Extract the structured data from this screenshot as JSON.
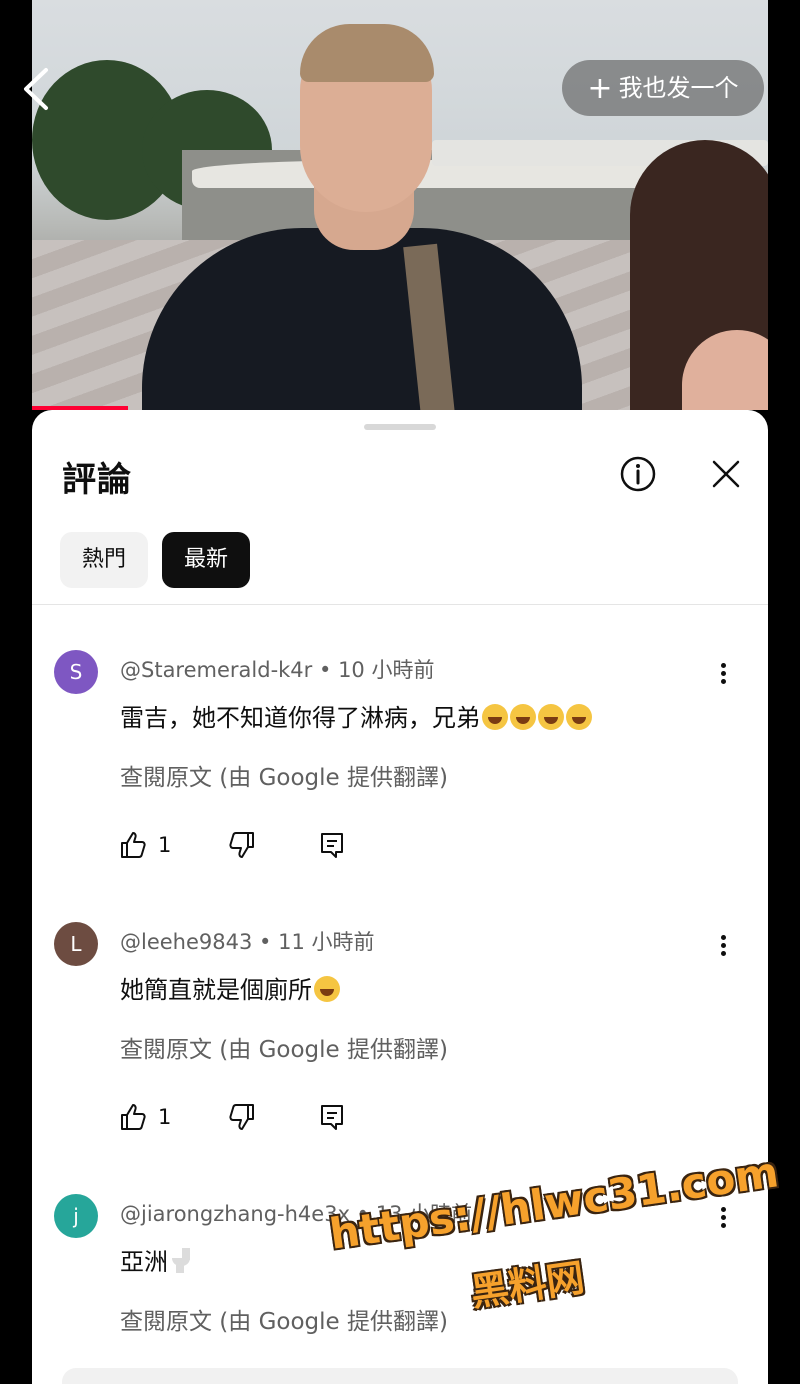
{
  "video": {
    "create_button_label": "我也发一个",
    "create_button_icon": "plus-icon",
    "back_icon": "chevron-left-icon",
    "progress_fraction": 0.13,
    "progress_color": "#ff0033"
  },
  "sheet": {
    "title": "評論",
    "info_icon": "info-icon",
    "close_icon": "close-icon",
    "chips": [
      {
        "label": "熱門",
        "selected": false
      },
      {
        "label": "最新",
        "selected": true
      }
    ]
  },
  "comments": [
    {
      "avatar_letter": "S",
      "avatar_color": "#7e57c2",
      "handle": "@Staremerald-k4r",
      "time": "10 小時前",
      "text": "雷吉，她不知道你得了淋病，兄弟",
      "emoji": "grinning-squint-face",
      "emoji_count": 4,
      "translate_label": "查閱原文 (由 Google 提供翻譯)",
      "likes": "1"
    },
    {
      "avatar_letter": "L",
      "avatar_color": "#6d4c41",
      "handle": "@leehe9843",
      "time": "11 小時前",
      "text": "她簡直就是個廁所",
      "emoji": "grinning-squint-face",
      "emoji_count": 1,
      "translate_label": "查閱原文 (由 Google 提供翻譯)",
      "likes": "1"
    },
    {
      "avatar_letter": "j",
      "avatar_color": "#26a69a",
      "handle": "@jiarongzhang-h4e3x",
      "time": "13 小時前",
      "text": "亞洲",
      "emoji": "toilet",
      "emoji_count": 1,
      "translate_label": "查閱原文 (由 Google 提供翻譯)",
      "likes": ""
    }
  ],
  "watermark": {
    "url": "https://hlwc31.com",
    "name": "黑料网"
  }
}
